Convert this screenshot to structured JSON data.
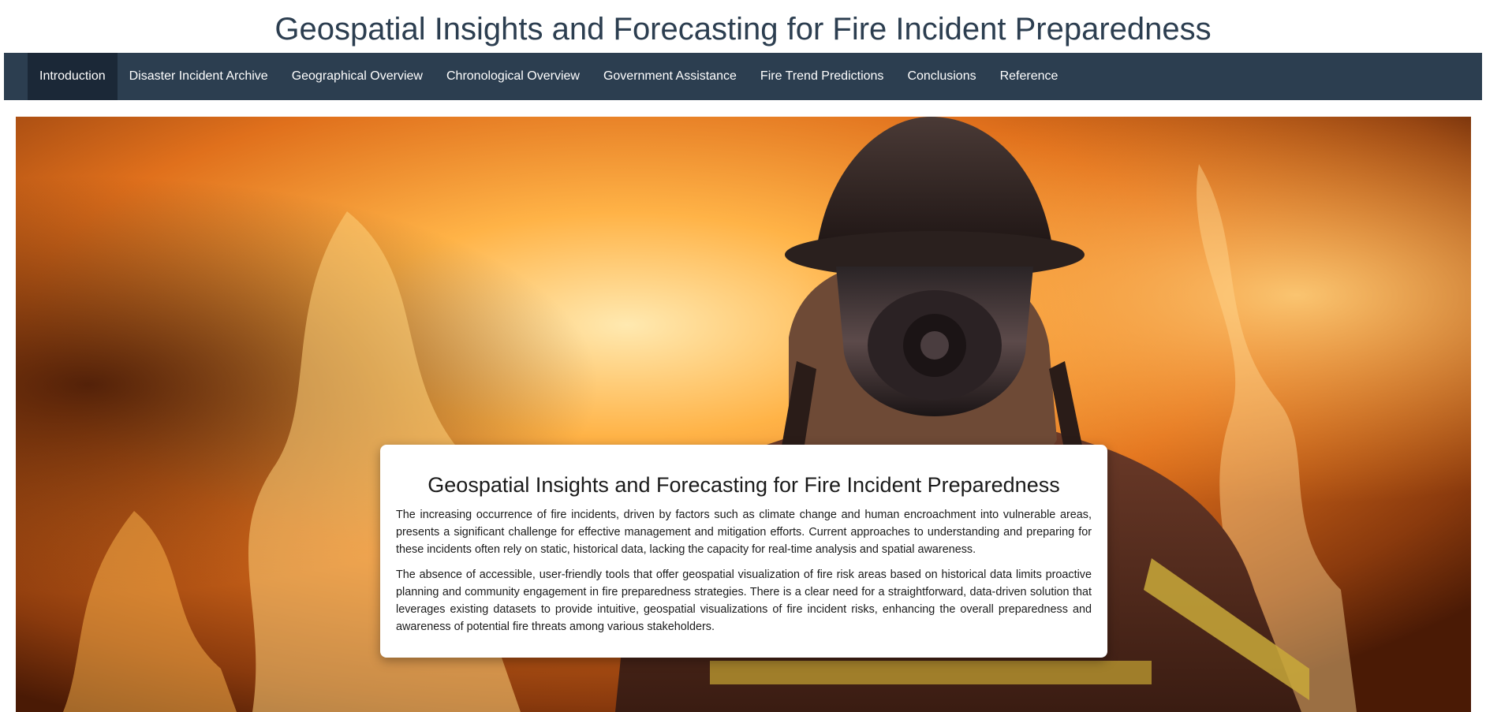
{
  "page_title": "Geospatial Insights and Forecasting for Fire Incident Preparedness",
  "nav": {
    "items": [
      {
        "label": "Introduction",
        "active": true
      },
      {
        "label": "Disaster Incident Archive",
        "active": false
      },
      {
        "label": "Geographical Overview",
        "active": false
      },
      {
        "label": "Chronological Overview",
        "active": false
      },
      {
        "label": "Government Assistance",
        "active": false
      },
      {
        "label": "Fire Trend Predictions",
        "active": false
      },
      {
        "label": "Conclusions",
        "active": false
      },
      {
        "label": "Reference",
        "active": false
      }
    ]
  },
  "hero": {
    "image_subject": "firefighter-in-flames",
    "card": {
      "title": "Geospatial Insights and Forecasting for Fire Incident Preparedness",
      "paragraphs": [
        "The increasing occurrence of fire incidents, driven by factors such as climate change and human encroachment into vulnerable areas, presents a significant challenge for effective management and mitigation efforts. Current approaches to understanding and preparing for these incidents often rely on static, historical data, lacking the capacity for real-time analysis and spatial awareness.",
        "The absence of accessible, user-friendly tools that offer geospatial visualization of fire risk areas based on historical data limits proactive planning and community engagement in fire preparedness strategies. There is a clear need for a straightforward, data-driven solution that leverages existing datasets to provide intuitive, geospatial visualizations of fire incident risks, enhancing the overall preparedness and awareness of potential fire threats among various stakeholders."
      ]
    }
  },
  "colors": {
    "title_text": "#2c3e50",
    "navbar_bg": "#2c3e50",
    "nav_active_bg": "#1b2837",
    "nav_text": "#ffffff",
    "card_bg": "#ffffff"
  }
}
